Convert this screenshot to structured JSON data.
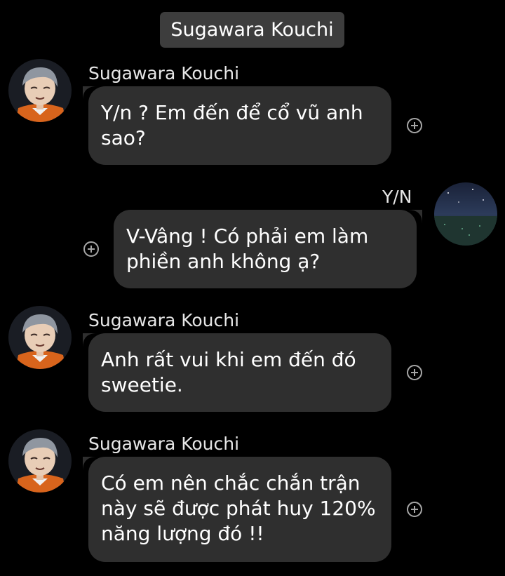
{
  "header": {
    "title": "Sugawara Kouchi"
  },
  "messages": [
    {
      "sender": "Sugawara Kouchi",
      "side": "left",
      "text": "Y/n ? Em đến để cổ vũ anh sao?",
      "avatar": "sugawara-avatar"
    },
    {
      "sender": "Y/N",
      "side": "right",
      "text": "V-Vâng ! Có phải em làm phiền anh không ạ?",
      "avatar": "night-sky-avatar"
    },
    {
      "sender": "Sugawara Kouchi",
      "side": "left",
      "text": "Anh rất vui khi em đến đó sweetie.",
      "avatar": "sugawara-avatar"
    },
    {
      "sender": "Sugawara Kouchi",
      "side": "left",
      "text": "Có em nên chắc chắn trận này sẽ được phát huy 120% năng lượng đó !!",
      "avatar": "sugawara-avatar"
    }
  ],
  "icons": {
    "react": "add-reaction-icon"
  },
  "colors": {
    "background": "#000000",
    "bubble": "#2f2f2f",
    "header_pill": "#3d3d3d"
  }
}
